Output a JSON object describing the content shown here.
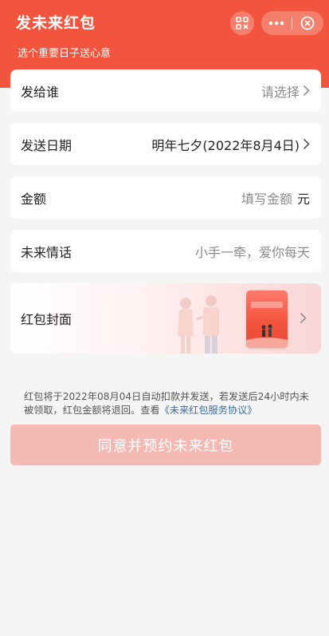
{
  "header": {
    "title": "发未来红包",
    "subtitle": "选个重要日子送心意",
    "bg_color": "#f2543d"
  },
  "rows": {
    "recipient": {
      "label": "发给谁",
      "value": "请选择"
    },
    "send_date": {
      "label": "发送日期",
      "value": "明年七夕(2022年8月4日)"
    },
    "amount": {
      "label": "金额",
      "placeholder": "填写金额",
      "unit": "元"
    },
    "message": {
      "label": "未来情话",
      "placeholder": "小手一牵，爱你每天"
    },
    "cover": {
      "label": "红包封面"
    }
  },
  "notice": {
    "text": "红包将于2022年08月04日自动扣款并发送，若发送后24小时内未被领取，红包金额将退回。查看",
    "link": "《未来红包服务协议》"
  },
  "submit_label": "同意并预约未来红包",
  "colors": {
    "accent": "#f2543d",
    "button_disabled": "#f5b9b3",
    "link": "#3a6ea5"
  }
}
